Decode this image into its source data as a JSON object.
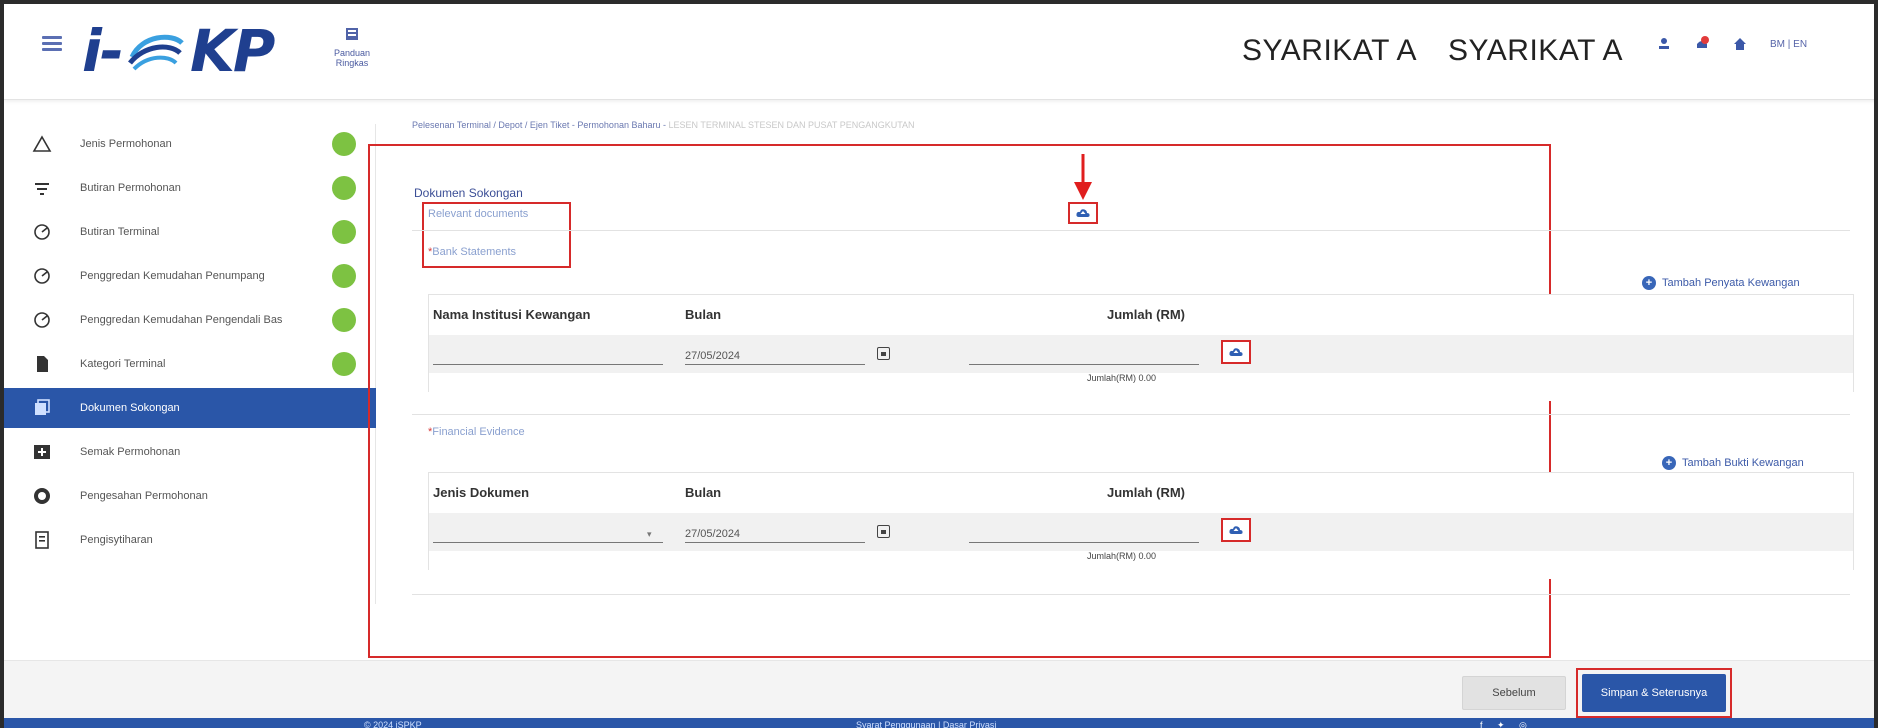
{
  "header": {
    "logo_text_1": "i-",
    "logo_text_2": "KP",
    "guide_label": "Panduan Ringkas",
    "company_1": "SYARIKAT A",
    "company_2": "SYARIKAT A",
    "lang": "BM | EN"
  },
  "sidebar": {
    "items": [
      {
        "label": "Jenis Permohonan",
        "done": true
      },
      {
        "label": "Butiran Permohonan",
        "done": true
      },
      {
        "label": "Butiran Terminal",
        "done": true
      },
      {
        "label": "Penggredan Kemudahan Penumpang",
        "done": true
      },
      {
        "label": "Penggredan Kemudahan Pengendali Bas",
        "done": true
      },
      {
        "label": "Kategori Terminal",
        "done": true
      },
      {
        "label": "Dokumen Sokongan",
        "active": true
      },
      {
        "label": "Semak Permohonan"
      },
      {
        "label": "Pengesahan Permohonan"
      },
      {
        "label": "Pengisytiharan"
      }
    ]
  },
  "breadcrumb": {
    "path": "Pelesenan Terminal / Depot / Ejen Tiket - Permohonan Baharu - ",
    "current": "LESEN TERMINAL STESEN DAN PUSAT PENGANGKUTAN"
  },
  "main": {
    "section_title": "Dokumen Sokongan",
    "relevant_docs": "Relevant documents",
    "bank_label": "Bank Statements",
    "bank_star": "*",
    "add_statement": "Tambah Penyata Kewangan",
    "table1": {
      "headers": [
        "Nama Institusi Kewangan",
        "Bulan",
        "Jumlah (RM)"
      ],
      "row": {
        "institution": "",
        "month": "27/05/2024",
        "amount": ""
      },
      "total": "Jumlah(RM) 0.00"
    },
    "financial_label": "Financial Evidence",
    "financial_star": "*",
    "add_evidence": "Tambah Bukti Kewangan",
    "table2": {
      "headers": [
        "Jenis Dokumen",
        "Bulan",
        "Jumlah (RM)"
      ],
      "row": {
        "doc_type": "",
        "month": "27/05/2024",
        "amount": ""
      },
      "total": "Jumlah(RM) 0.00"
    }
  },
  "actions": {
    "prev": "Sebelum",
    "next": "Simpan & Seterusnya"
  },
  "footer": {
    "copyright": "© 2024 iSPKP",
    "links": "Syarat Penggunaan | Dasar Privasi"
  },
  "colors": {
    "primary": "#2a56a8",
    "highlight": "#d62a2a",
    "success": "#7dc242"
  }
}
